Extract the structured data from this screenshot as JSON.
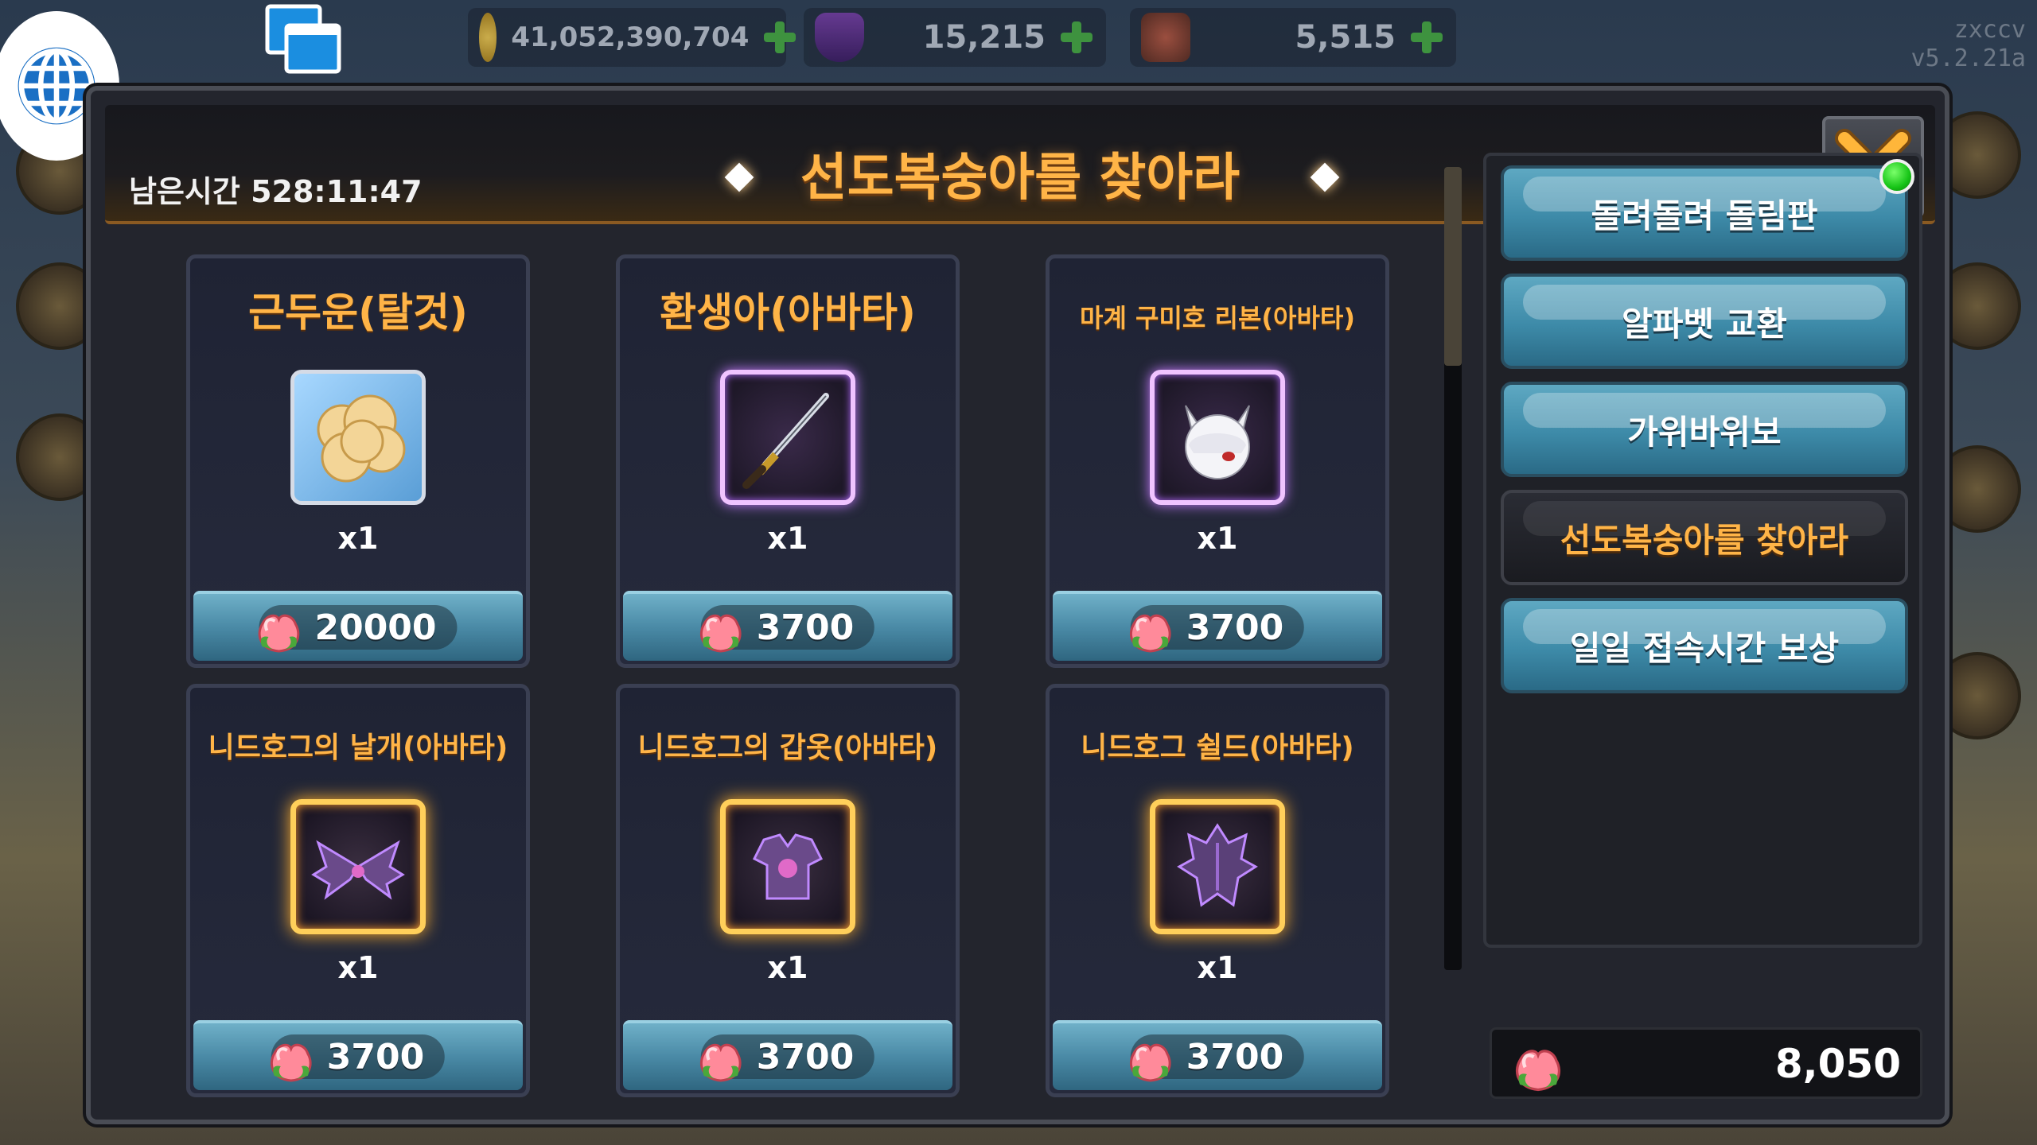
{
  "hud": {
    "gold": "41,052,390,704",
    "gems": "15,215",
    "tickets": "5,515",
    "version_user": "zxccv",
    "version": "v5.2.21a"
  },
  "header": {
    "timer": "남은시간 528:11:47",
    "title": "선도복숭아를 찾아라"
  },
  "items": [
    {
      "name": "근두운(탈것)",
      "qty": "x1",
      "price": "20000",
      "icon": "cloud-icon"
    },
    {
      "name": "환생아(아바타)",
      "qty": "x1",
      "price": "3700",
      "icon": "sword-icon"
    },
    {
      "name": "마계 구미호 리본(아바타)",
      "qty": "x1",
      "price": "3700",
      "icon": "fox-ribbon-icon"
    },
    {
      "name": "니드호그의 날개(아바타)",
      "qty": "x1",
      "price": "3700",
      "icon": "wings-icon"
    },
    {
      "name": "니드호그의 갑옷(아바타)",
      "qty": "x1",
      "price": "3700",
      "icon": "armor-icon"
    },
    {
      "name": "니드호그 쉴드(아바타)",
      "qty": "x1",
      "price": "3700",
      "icon": "shield-icon"
    }
  ],
  "menu": [
    {
      "label": "돌려돌려 돌림판",
      "active": false,
      "notify": true
    },
    {
      "label": "알파벳 교환",
      "active": false,
      "notify": false
    },
    {
      "label": "가위바위보",
      "active": false,
      "notify": false
    },
    {
      "label": "선도복숭아를 찾아라",
      "active": true,
      "notify": false
    },
    {
      "label": "일일 접속시간 보상",
      "active": false,
      "notify": false
    }
  ],
  "balance": "8,050",
  "colors": {
    "accent_orange": "#ffb447",
    "button_blue": "#3d8aa8",
    "notify_green": "#17c417"
  }
}
